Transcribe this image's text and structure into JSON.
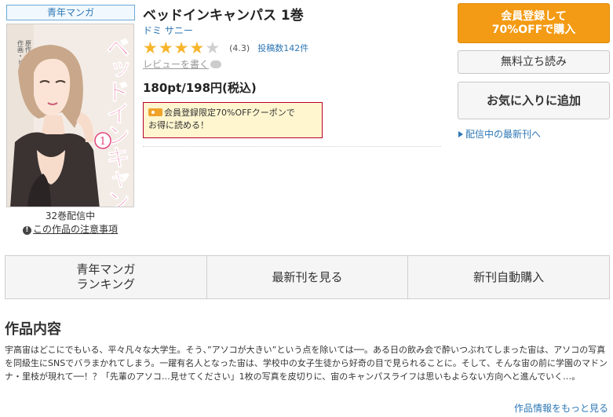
{
  "genre_tag": "青年マンガ",
  "cover": {
    "title_art": "ベッドインキャンパス",
    "volume_mark": "1",
    "credits_line1": "作画・ドミ",
    "credits_line2": "原作・サニー",
    "background_color": "#f3ece6",
    "title_color": "#e6457e"
  },
  "volume_count": "32巻配信中",
  "caution_link": "この作品の注意事項",
  "book": {
    "title": "ベッドインキャンパス 1巻",
    "author": "ドミ サニー",
    "rating_stars": 4.3,
    "rating_text": "(4.3)",
    "review_count": "投稿数142件",
    "write_review": "レビューを書く",
    "price": "180pt/198円(税込)"
  },
  "coupon": {
    "line1": "会員登録限定70%OFFクーポンで",
    "line2": "お得に読める！"
  },
  "buttons": {
    "member_line1": "会員登録して",
    "member_line2": "70%OFFで購入",
    "trial": "無料立ち読み",
    "favorite": "お気に入りに追加",
    "latest": "配信中の最新刊へ"
  },
  "nav": {
    "ranking_line1": "青年マンガ",
    "ranking_line2": "ランキング",
    "latest": "最新刊を見る",
    "auto_buy": "新刊自動購入"
  },
  "section": {
    "title": "作品内容",
    "description": "宇高宙はどこにでもいる、平々凡々な大学生。そう、”アソコが大きい”という点を除いては──。ある日の飲み会で酔いつぶれてしまった宙は、アソコの写真を同級生にSNSでバラまかれてしまう。一躍有名人となった宙は、学校中の女子生徒から好奇の目で見られることに。そして、そんな宙の前に学園のマドンナ・里枝が現れて──！？「先輩のアソコ…見せてください」1枚の写真を皮切りに、宙のキャンパスライフは思いもよらない方向へと進んでいく…。",
    "more": "作品情報をもっと見る"
  },
  "colors": {
    "accent_orange": "#f39b14",
    "link_blue": "#2d77b5",
    "star_gold": "#f7b52c",
    "coupon_border": "#b8002e",
    "coupon_bg": "#fff6cf"
  }
}
